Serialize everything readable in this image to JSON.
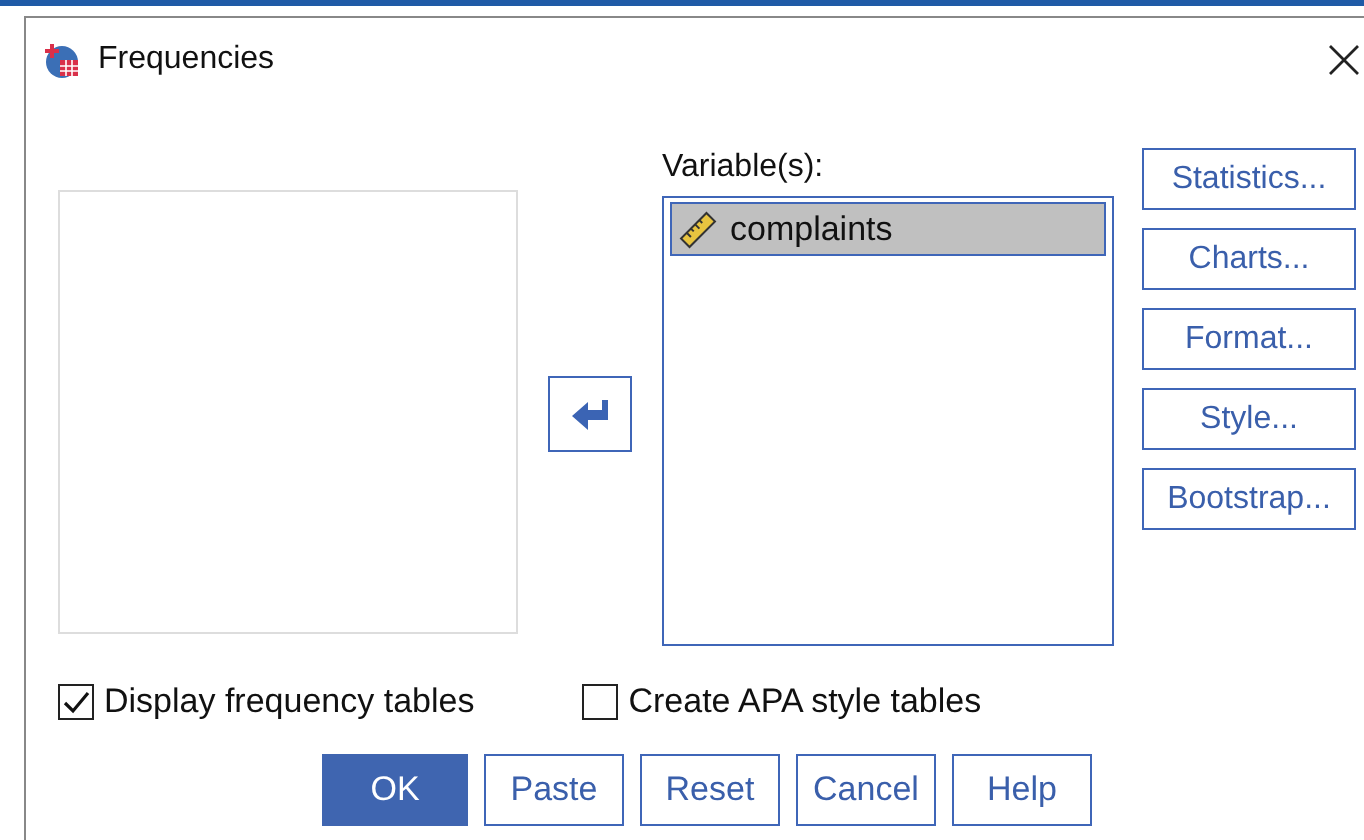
{
  "window": {
    "title": "Frequencies"
  },
  "variables": {
    "label": "Variable(s):",
    "items": [
      {
        "name": "complaints",
        "selected": true
      }
    ]
  },
  "side_buttons": [
    "Statistics...",
    "Charts...",
    "Format...",
    "Style...",
    "Bootstrap..."
  ],
  "options": [
    {
      "label": "Display frequency tables",
      "checked": true
    },
    {
      "label": "Create APA style tables",
      "checked": false
    }
  ],
  "buttons": [
    {
      "label": "OK",
      "kind": "default"
    },
    {
      "label": "Paste",
      "kind": "normal"
    },
    {
      "label": "Reset",
      "kind": "normal"
    },
    {
      "label": "Cancel",
      "kind": "normal"
    },
    {
      "label": "Help",
      "kind": "normal"
    }
  ]
}
